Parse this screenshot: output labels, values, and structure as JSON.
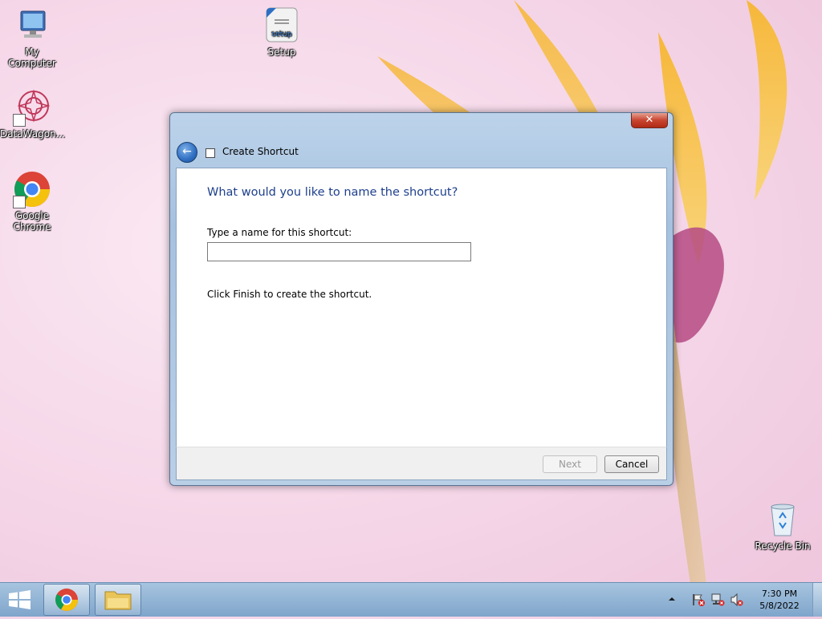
{
  "desktop": {
    "icons": [
      {
        "label": "My Computer",
        "icon": "computer-icon"
      },
      {
        "label": "DataWagon...",
        "icon": "datawagon-icon"
      },
      {
        "label": "Google Chrome",
        "icon": "chrome-icon"
      },
      {
        "label": "Setup",
        "icon": "setup-icon"
      },
      {
        "label": "Recycle Bin",
        "icon": "recycle-bin-icon"
      }
    ]
  },
  "dialog": {
    "title": "Create Shortcut",
    "close_label": "✕",
    "heading": "What would you like to name the shortcut?",
    "field_label": "Type a name for this shortcut:",
    "name_value": "",
    "info": "Click Finish to create the shortcut.",
    "next_label": "Next",
    "cancel_label": "Cancel"
  },
  "taskbar": {
    "time": "7:30 PM",
    "date": "5/8/2022",
    "tray_icons": [
      "show-hidden-icons-icon",
      "action-center-icon",
      "network-icon",
      "volume-muted-icon"
    ]
  }
}
